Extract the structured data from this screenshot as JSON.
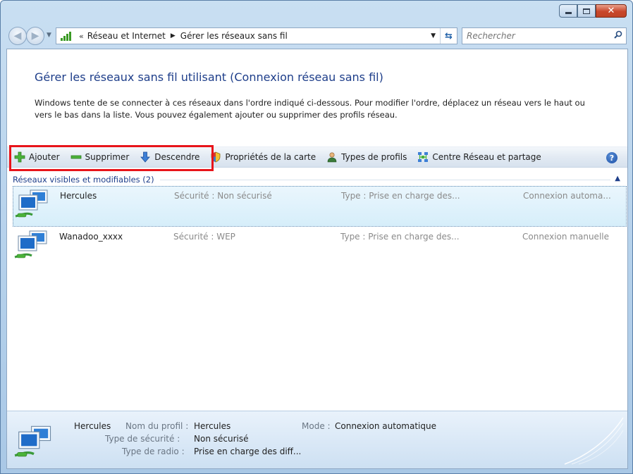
{
  "window": {
    "caption_buttons": [
      "minimize",
      "maximize",
      "close"
    ]
  },
  "address": {
    "chevrons": "«",
    "crumbs": [
      "Réseau et Internet",
      "Gérer les réseaux sans fil"
    ],
    "search_placeholder": "Rechercher"
  },
  "header": {
    "title": "Gérer les réseaux sans fil utilisant (Connexion réseau sans fil)",
    "description": "Windows tente de se connecter à ces réseaux dans l'ordre indiqué ci-dessous. Pour modifier l'ordre, déplacez un réseau vers le haut ou vers le bas dans la liste. Vous pouvez également ajouter ou supprimer des profils réseau."
  },
  "toolbar": {
    "add_label": "Ajouter",
    "remove_label": "Supprimer",
    "down_label": "Descendre",
    "adapter_props_label": "Propriétés de la carte",
    "profile_types_label": "Types de profils",
    "network_center_label": "Centre Réseau et partage"
  },
  "group": {
    "label": "Réseaux visibles et modifiables (2)"
  },
  "networks": [
    {
      "name": "Hercules",
      "security": "Sécurité : Non sécurisé",
      "type": "Type : Prise en charge des...",
      "mode": "Connexion automa...",
      "selected": true
    },
    {
      "name": "Wanadoo_xxxx",
      "security": "Sécurité : WEP",
      "type": "Type : Prise en charge des...",
      "mode": "Connexion manuelle",
      "selected": false
    }
  ],
  "details": {
    "name": "Hercules",
    "profile_label": "Nom du profil :",
    "profile_value": "Hercules",
    "mode_label": "Mode :",
    "mode_value": "Connexion automatique",
    "security_label": "Type de sécurité :",
    "security_value": "Non sécurisé",
    "radio_label": "Type de radio :",
    "radio_value": "Prise en charge des diff..."
  },
  "colors": {
    "accent": "#1e3e8a",
    "highlight_box": "#e8141a",
    "selection": "#d6eefa"
  }
}
